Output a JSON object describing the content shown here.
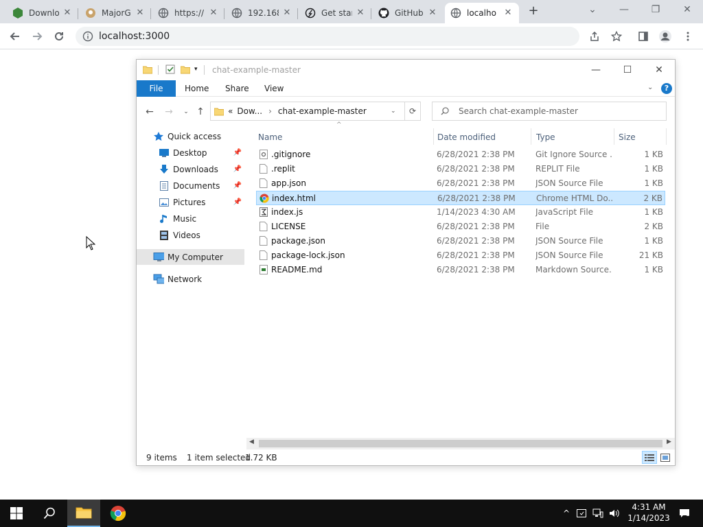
{
  "browser": {
    "tabs": [
      {
        "label": "Downlo",
        "icon": "nodejs-icon",
        "favcolor": "#3c873a"
      },
      {
        "label": "MajorG",
        "icon": "majorgeeks-icon",
        "favcolor": "#8a6d3b"
      },
      {
        "label": "https://",
        "icon": "globe-icon",
        "favcolor": "#5f6368"
      },
      {
        "label": "192.168",
        "icon": "globe-icon",
        "favcolor": "#5f6368"
      },
      {
        "label": "Get star",
        "icon": "compass-icon",
        "favcolor": "#202124"
      },
      {
        "label": "GitHub",
        "icon": "github-icon",
        "favcolor": "#202124"
      },
      {
        "label": "localho",
        "icon": "globe-icon",
        "favcolor": "#5f6368"
      }
    ],
    "active_tab": 6,
    "url": "localhost:3000"
  },
  "explorer": {
    "title": "chat-example-master",
    "ribbon": {
      "file": "File",
      "home": "Home",
      "share": "Share",
      "view": "View"
    },
    "address": {
      "prefix": "«",
      "parent": "Dow...",
      "sep": "›",
      "current": "chat-example-master"
    },
    "search_placeholder": "Search chat-example-master",
    "nav": [
      {
        "label": "Quick access",
        "icon": "star-icon",
        "pinned": false,
        "indent": 0
      },
      {
        "label": "Desktop",
        "icon": "desktop-icon",
        "pinned": true,
        "indent": 1
      },
      {
        "label": "Downloads",
        "icon": "download-icon",
        "pinned": true,
        "indent": 1
      },
      {
        "label": "Documents",
        "icon": "documents-icon",
        "pinned": true,
        "indent": 1
      },
      {
        "label": "Pictures",
        "icon": "pictures-icon",
        "pinned": true,
        "indent": 1
      },
      {
        "label": "Music",
        "icon": "music-icon",
        "pinned": false,
        "indent": 1
      },
      {
        "label": "Videos",
        "icon": "videos-icon",
        "pinned": false,
        "indent": 1
      },
      {
        "label": "My Computer",
        "icon": "computer-icon",
        "pinned": false,
        "indent": 0
      },
      {
        "label": "Network",
        "icon": "network-icon",
        "pinned": false,
        "indent": 0
      }
    ],
    "nav_selected": 7,
    "columns": {
      "name": "Name",
      "date": "Date modified",
      "type": "Type",
      "size": "Size"
    },
    "files": [
      {
        "name": ".gitignore",
        "date": "6/28/2021 2:38 PM",
        "type": "Git Ignore Source ...",
        "size": "1 KB",
        "icon": "gear-file-icon"
      },
      {
        "name": ".replit",
        "date": "6/28/2021 2:38 PM",
        "type": "REPLIT File",
        "size": "1 KB",
        "icon": "file-icon"
      },
      {
        "name": "app.json",
        "date": "6/28/2021 2:38 PM",
        "type": "JSON Source File",
        "size": "1 KB",
        "icon": "file-icon"
      },
      {
        "name": "index.html",
        "date": "6/28/2021 2:38 PM",
        "type": "Chrome HTML Do...",
        "size": "2 KB",
        "icon": "chrome-icon"
      },
      {
        "name": "index.js",
        "date": "1/14/2023 4:30 AM",
        "type": "JavaScript File",
        "size": "1 KB",
        "icon": "script-file-icon"
      },
      {
        "name": "LICENSE",
        "date": "6/28/2021 2:38 PM",
        "type": "File",
        "size": "2 KB",
        "icon": "file-icon"
      },
      {
        "name": "package.json",
        "date": "6/28/2021 2:38 PM",
        "type": "JSON Source File",
        "size": "1 KB",
        "icon": "file-icon"
      },
      {
        "name": "package-lock.json",
        "date": "6/28/2021 2:38 PM",
        "type": "JSON Source File",
        "size": "21 KB",
        "icon": "file-icon"
      },
      {
        "name": "README.md",
        "date": "6/28/2021 2:38 PM",
        "type": "Markdown Source...",
        "size": "1 KB",
        "icon": "markdown-file-icon"
      }
    ],
    "selected_file": 3,
    "status": {
      "items": "9 items",
      "selected": "1 item selected",
      "size": "1.72 KB"
    }
  },
  "taskbar": {
    "time": "4:31 AM",
    "date": "1/14/2023",
    "notifications": "1"
  },
  "colors": {
    "accent": "#1979ca",
    "selection": "#cce8ff",
    "taskbar": "#101010"
  }
}
